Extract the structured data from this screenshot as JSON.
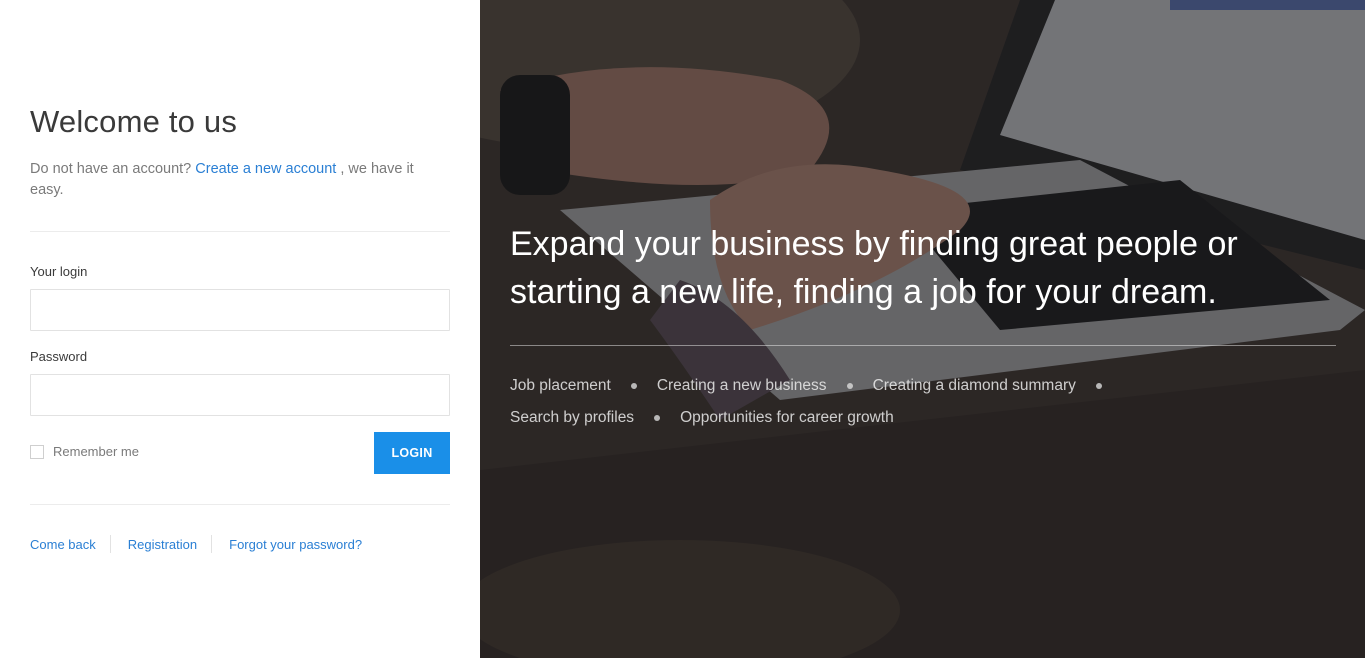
{
  "login_panel": {
    "title": "Welcome to us",
    "subtitle_prefix": "Do not have an account?",
    "create_account_link": "Create a new account",
    "subtitle_suffix": ", we have it easy.",
    "login_label": "Your login",
    "login_value": "",
    "password_label": "Password",
    "password_value": "",
    "remember_label": "Remember me",
    "remember_checked": false,
    "login_button": "LOGIN",
    "footer_links": [
      "Come back",
      "Registration",
      "Forgot your password?"
    ]
  },
  "hero": {
    "headline": "Expand your business by finding great people or starting a new life, finding a job for your dream.",
    "features": [
      "Job placement",
      "Creating a new business",
      "Creating a diamond summary",
      "Search by profiles",
      "Opportunities for career growth"
    ]
  },
  "colors": {
    "accent": "#1a8fe8",
    "link": "#2a7fd4",
    "overlay": "#141416"
  }
}
